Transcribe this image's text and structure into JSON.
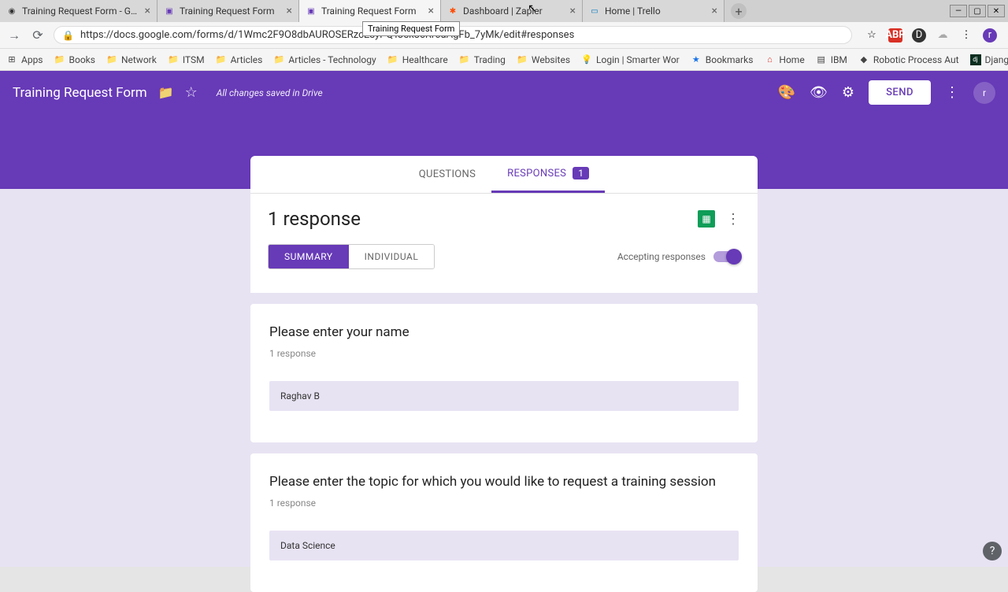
{
  "browser": {
    "tabs": [
      {
        "title": "Training Request Form - Google"
      },
      {
        "title": "Training Request Form"
      },
      {
        "title": "Training Request Form"
      },
      {
        "title": "Dashboard | Zapier"
      },
      {
        "title": "Home | Trello"
      }
    ],
    "tooltip": "Training Request Form",
    "url": "https://docs.google.com/forms/d/1Wmc2F9O8dbAUROSERzcEsyPQTJsk3cRr6aAgFb_7yMk/edit#responses"
  },
  "bookmarks": {
    "apps": "Apps",
    "items": [
      "Books",
      "Network",
      "ITSM",
      "Articles",
      "Articles - Technology",
      "Healthcare",
      "Trading",
      "Websites",
      "Login | Smarter Wor",
      "Bookmarks",
      "Home",
      "IBM",
      "Robotic Process Aut",
      "Django Community"
    ]
  },
  "header": {
    "title": "Training Request Form",
    "save_status": "All changes saved in Drive",
    "send_label": "SEND",
    "avatar": "r"
  },
  "form_tabs": {
    "questions": "QUESTIONS",
    "responses": "RESPONSES",
    "badge": "1"
  },
  "responses": {
    "title": "1 response",
    "summary": "SUMMARY",
    "individual": "INDIVIDUAL",
    "accepting": "Accepting responses"
  },
  "questions": [
    {
      "title": "Please enter your name",
      "sub": "1 response",
      "answer": "Raghav B"
    },
    {
      "title": "Please enter the topic for which you would like to request a training session",
      "sub": "1 response",
      "answer": "Data Science"
    }
  ]
}
